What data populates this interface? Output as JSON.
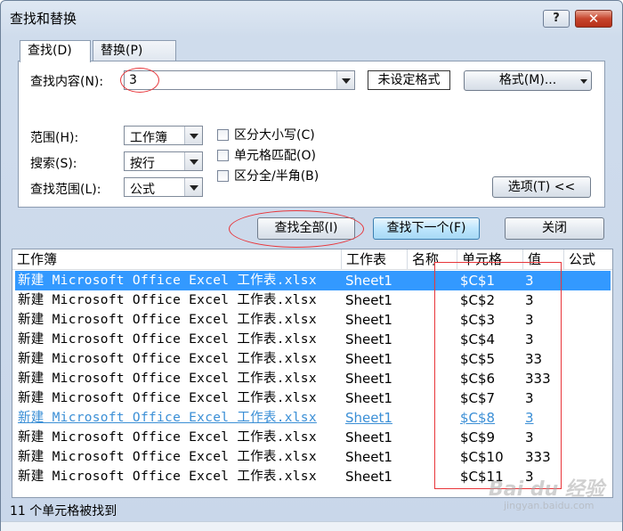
{
  "window": {
    "title": "查找和替换",
    "help_label": "?",
    "close_label": "✕"
  },
  "tabs": [
    {
      "label": "查找(D)",
      "active": true
    },
    {
      "label": "替换(P)",
      "active": false
    }
  ],
  "find": {
    "label": "查找内容(N):",
    "value": "3",
    "no_format_label": "未设定格式",
    "format_button": "格式(M)..."
  },
  "options": {
    "scope_label": "范围(H):",
    "scope_value": "工作簿",
    "search_label": "搜索(S):",
    "search_value": "按行",
    "lookin_label": "查找范围(L):",
    "lookin_value": "公式",
    "match_case": "区分大小写(C)",
    "match_cell": "单元格匹配(O)",
    "match_width": "区分全/半角(B)",
    "options_button": "选项(T) <<"
  },
  "buttons": {
    "find_all": "查找全部(I)",
    "find_next": "查找下一个(F)",
    "close": "关闭"
  },
  "results": {
    "columns": [
      "工作簿",
      "工作表",
      "名称",
      "单元格",
      "值",
      "公式"
    ],
    "rows": [
      {
        "book": "新建 Microsoft Office Excel 工作表.xlsx",
        "sheet": "Sheet1",
        "name": "",
        "cell": "$C$1",
        "value": "3"
      },
      {
        "book": "新建 Microsoft Office Excel 工作表.xlsx",
        "sheet": "Sheet1",
        "name": "",
        "cell": "$C$2",
        "value": "3"
      },
      {
        "book": "新建 Microsoft Office Excel 工作表.xlsx",
        "sheet": "Sheet1",
        "name": "",
        "cell": "$C$3",
        "value": "3"
      },
      {
        "book": "新建 Microsoft Office Excel 工作表.xlsx",
        "sheet": "Sheet1",
        "name": "",
        "cell": "$C$4",
        "value": "3"
      },
      {
        "book": "新建 Microsoft Office Excel 工作表.xlsx",
        "sheet": "Sheet1",
        "name": "",
        "cell": "$C$5",
        "value": "33"
      },
      {
        "book": "新建 Microsoft Office Excel 工作表.xlsx",
        "sheet": "Sheet1",
        "name": "",
        "cell": "$C$6",
        "value": "333"
      },
      {
        "book": "新建 Microsoft Office Excel 工作表.xlsx",
        "sheet": "Sheet1",
        "name": "",
        "cell": "$C$7",
        "value": "3"
      },
      {
        "book": "新建 Microsoft Office Excel 工作表.xlsx",
        "sheet": "Sheet1",
        "name": "",
        "cell": "$C$8",
        "value": "3"
      },
      {
        "book": "新建 Microsoft Office Excel 工作表.xlsx",
        "sheet": "Sheet1",
        "name": "",
        "cell": "$C$9",
        "value": "3"
      },
      {
        "book": "新建 Microsoft Office Excel 工作表.xlsx",
        "sheet": "Sheet1",
        "name": "",
        "cell": "$C$10",
        "value": "333"
      },
      {
        "book": "新建 Microsoft Office Excel 工作表.xlsx",
        "sheet": "Sheet1",
        "name": "",
        "cell": "$C$11",
        "value": "3"
      }
    ]
  },
  "status": "11 个单元格被找到",
  "watermark": {
    "main": "Bai du 经验",
    "sub": "jingyan.baidu.com"
  },
  "colors": {
    "selection": "#3399ff",
    "link": "#3b8fd6",
    "annotation": "#e8353a"
  }
}
